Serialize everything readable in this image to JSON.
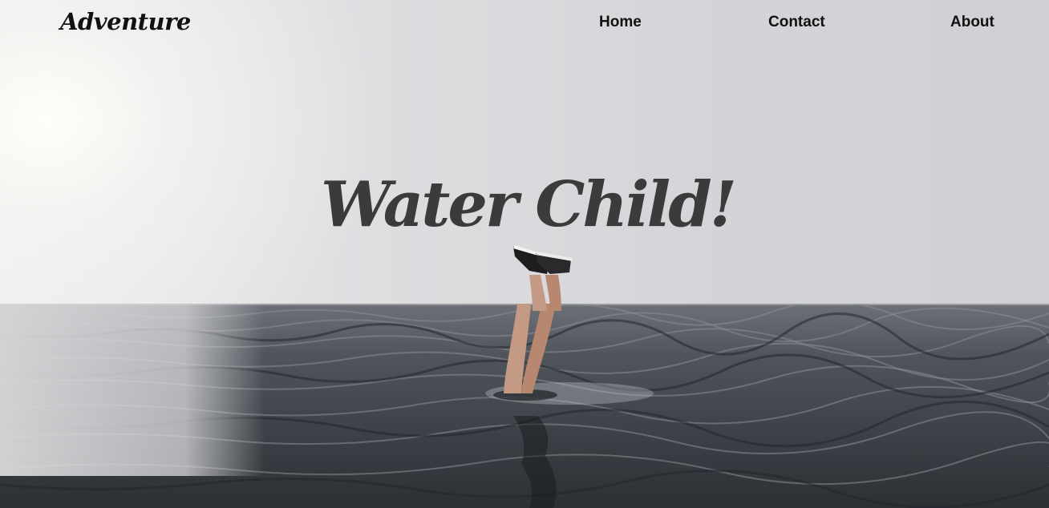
{
  "nav": {
    "brand": "Adventure",
    "links": [
      {
        "label": "Home"
      },
      {
        "label": "Contact"
      },
      {
        "label": "About"
      }
    ]
  },
  "hero": {
    "title": "Water Child!"
  },
  "colors": {
    "text_dark": "#111111",
    "title_gray": "#3b3b3b",
    "sea_dark": "#2f3338",
    "sky_light": "#dcdce0"
  }
}
